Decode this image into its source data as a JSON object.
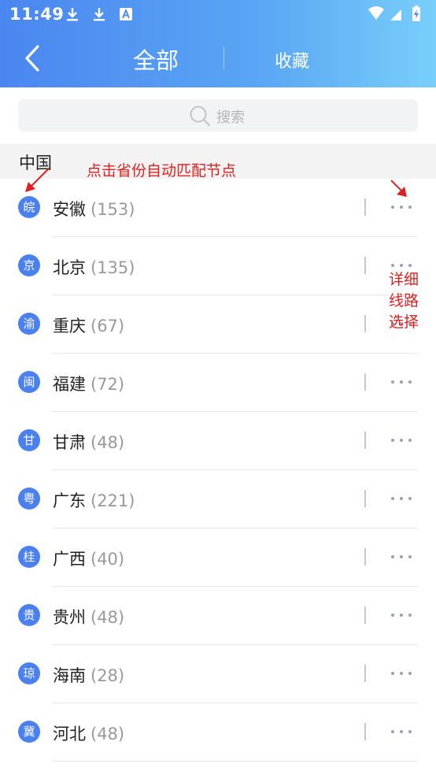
{
  "status_bar": {
    "time": "11:49"
  },
  "header": {
    "back_icon": "chevron-left-icon",
    "title": "全部",
    "favorites": "收藏"
  },
  "search": {
    "placeholder": "搜索",
    "icon": "search-icon"
  },
  "section": {
    "title": "中国"
  },
  "provinces": [
    {
      "badge": "皖",
      "name": "安徽",
      "count": "(153)"
    },
    {
      "badge": "京",
      "name": "北京",
      "count": "(135)"
    },
    {
      "badge": "渝",
      "name": "重庆",
      "count": "(67)"
    },
    {
      "badge": "闽",
      "name": "福建",
      "count": "(72)"
    },
    {
      "badge": "甘",
      "name": "甘肃",
      "count": "(48)"
    },
    {
      "badge": "粤",
      "name": "广东",
      "count": "(221)"
    },
    {
      "badge": "桂",
      "name": "广西",
      "count": "(40)"
    },
    {
      "badge": "贵",
      "name": "贵州",
      "count": "(48)"
    },
    {
      "badge": "琼",
      "name": "海南",
      "count": "(28)"
    },
    {
      "badge": "冀",
      "name": "河北",
      "count": "(48)"
    }
  ],
  "annotations": {
    "auto_match": "点击省份自动匹配节点",
    "detail_line_1": "详细",
    "detail_line_2": "线路",
    "detail_line_3": "选择"
  },
  "colors": {
    "header_start": "#4a86f0",
    "header_end": "#78cffa",
    "badge": "#4a80f0",
    "annotation": "#e02020"
  }
}
